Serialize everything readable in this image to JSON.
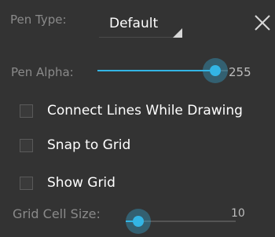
{
  "pen_type": {
    "label": "Pen Type:",
    "selected": "Default"
  },
  "pen_alpha": {
    "label": "Pen Alpha:",
    "value": "255",
    "level": 1.0
  },
  "checkboxes": [
    {
      "label": "Connect Lines While Drawing",
      "checked": false
    },
    {
      "label": "Snap to Grid",
      "checked": false
    },
    {
      "label": "Show Grid",
      "checked": false
    }
  ],
  "grid_cell_size": {
    "label": "Grid Cell Size:",
    "value": "10",
    "level": 0.0
  },
  "icons": {
    "close": "close-icon",
    "dropdown": "spinner-arrow-icon"
  },
  "colors": {
    "accent": "#33b5e5",
    "background": "#333333"
  }
}
